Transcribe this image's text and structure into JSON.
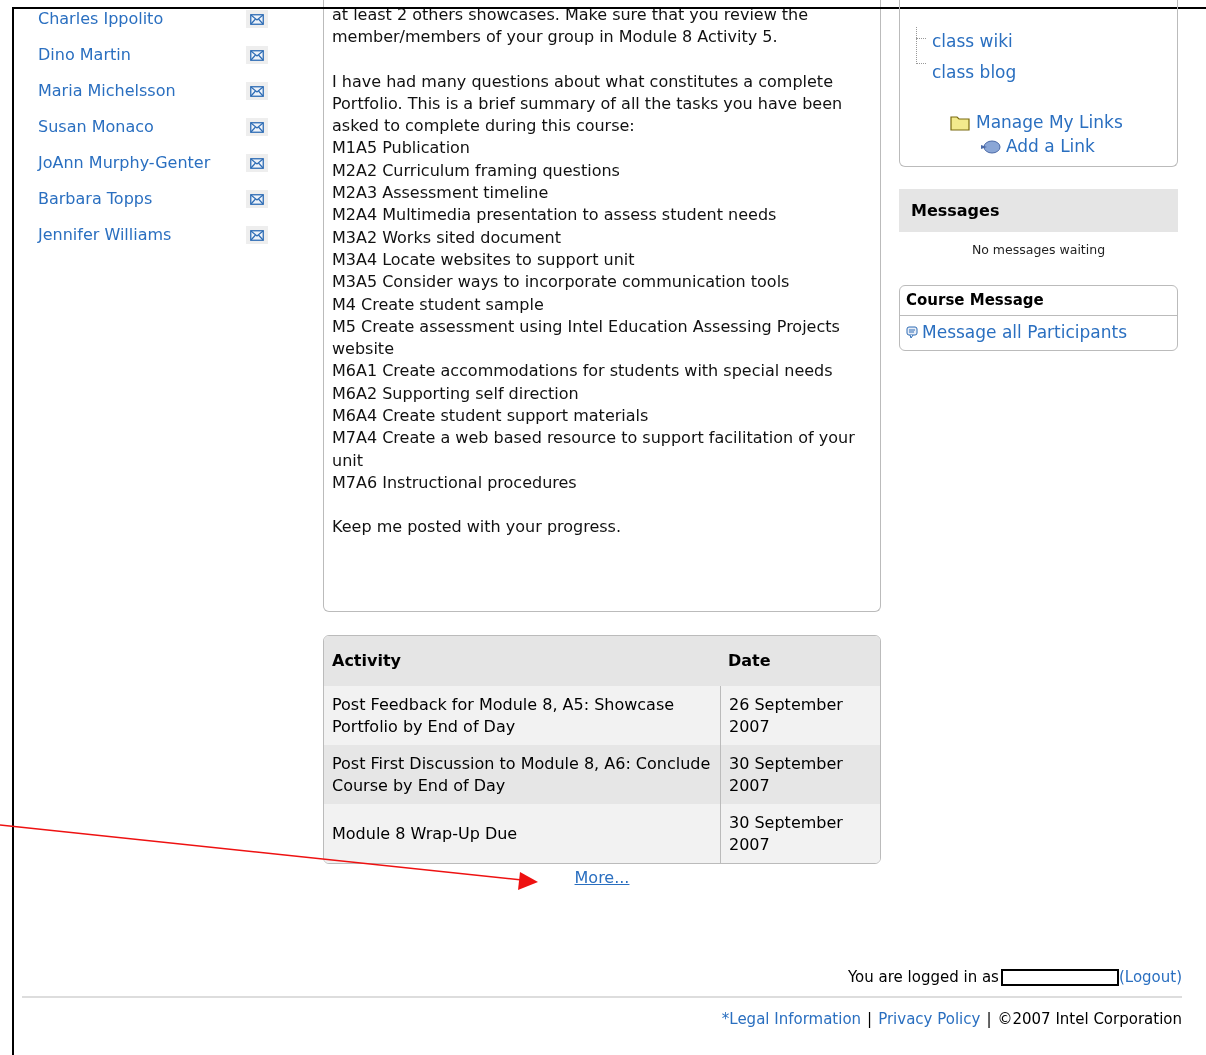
{
  "participants": [
    {
      "name": "Charles Ippolito"
    },
    {
      "name": "Dino Martin"
    },
    {
      "name": "Maria Michelsson"
    },
    {
      "name": "Susan Monaco"
    },
    {
      "name": "JoAnn Murphy-Genter"
    },
    {
      "name": "Barbara Topps"
    },
    {
      "name": "Jennifer Williams"
    }
  ],
  "message": {
    "paragraphs": [
      "at least 2 others showcases. Make sure that you review the member/members of your group in Module 8 Activity 5.",
      "I have had many questions about what constitutes a complete Portfolio. This is a brief summary of all the tasks you have been asked to complete during this course:"
    ],
    "tasks": [
      "M1A5 Publication",
      "M2A2 Curriculum framing questions",
      "M2A3 Assessment timeline",
      "M2A4 Multimedia presentation to assess student needs",
      "M3A2 Works sited document",
      "M3A4 Locate websites to support unit",
      "M3A5 Consider ways to incorporate communication tools",
      "M4 Create student sample",
      "M5 Create assessment using Intel Education Assessing Projects website",
      "M6A1 Create accommodations for students with special needs",
      "M6A2 Supporting self direction",
      "M6A4 Create student support materials",
      "M7A4 Create a web based resource to support facilitation of your unit",
      "M7A6 Instructional procedures"
    ],
    "closing": "Keep me posted with your progress."
  },
  "activities": {
    "columns": [
      "Activity",
      "Date"
    ],
    "rows": [
      {
        "activity": "Post Feedback for Module 8, A5: Showcase Portfolio by End of Day",
        "date": "26 September 2007"
      },
      {
        "activity": "Post First Discussion to Module 8, A6: Conclude Course by End of Day",
        "date": "30 September 2007"
      },
      {
        "activity": "Module 8 Wrap-Up Due",
        "date": "30 September 2007"
      }
    ],
    "more_link": "More..."
  },
  "links_panel": {
    "items": [
      "class wiki",
      "class blog"
    ],
    "manage": "Manage My Links",
    "add": "Add a Link"
  },
  "messages_panel": {
    "title": "Messages",
    "status": "No messages waiting"
  },
  "course_message": {
    "title": "Course Message",
    "link": "Message all Participants"
  },
  "footer": {
    "logged_in_text": "You are logged in as",
    "logout": "(Logout)",
    "items": [
      {
        "kind": "link",
        "text": "*Legal Information"
      },
      {
        "kind": "text",
        "text": "|"
      },
      {
        "kind": "link",
        "text": "Privacy Policy"
      },
      {
        "kind": "text",
        "text": "|"
      },
      {
        "kind": "text",
        "text": "©2007 Intel Corporation"
      }
    ]
  }
}
